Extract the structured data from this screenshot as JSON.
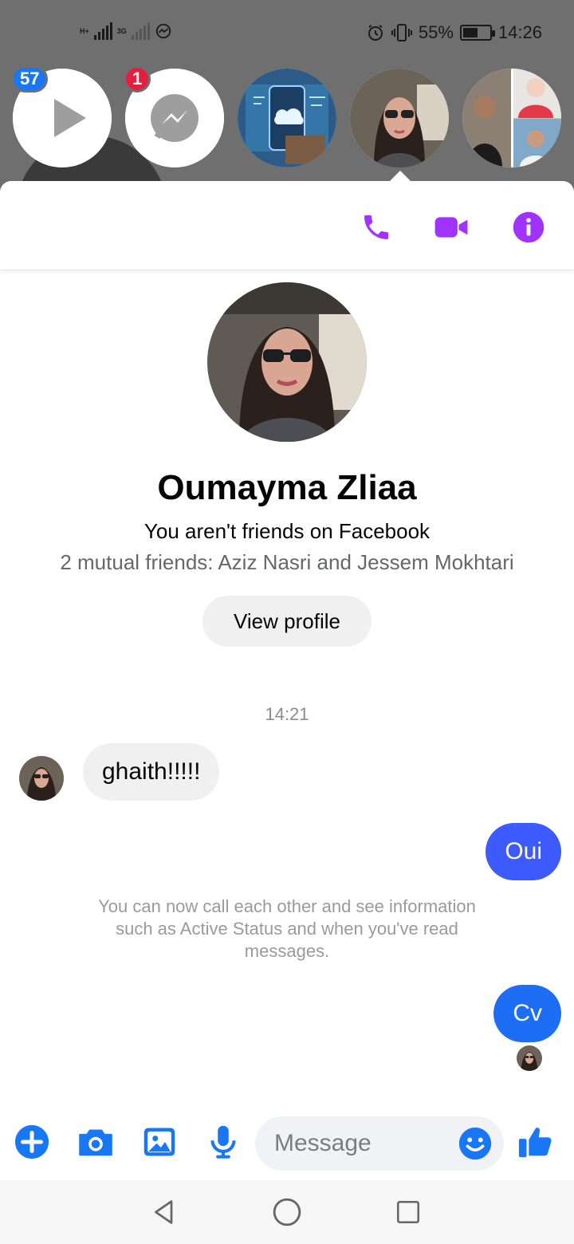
{
  "status_bar": {
    "network_left": "H+",
    "network_right": "3G",
    "battery_percent": "55%",
    "battery_level": 0.55,
    "time": "14:26",
    "icons": [
      "alarm-icon",
      "vibrate-icon",
      "battery-icon",
      "messenger-status-icon"
    ]
  },
  "chat_heads": [
    {
      "name": "video-app-head",
      "badge": "57",
      "icon": "play-icon"
    },
    {
      "name": "messenger-head",
      "badge": "1",
      "icon": "messenger-icon"
    },
    {
      "name": "tech-cloud-head",
      "icon": "cloud-photo"
    },
    {
      "name": "oumayma-head",
      "icon": "profile-photo",
      "active": true
    },
    {
      "name": "group-head",
      "icon": "group-photo"
    }
  ],
  "header": {
    "actions": [
      "phone-icon",
      "video-icon",
      "info-icon"
    ],
    "accent": "#a033ff"
  },
  "profile": {
    "name": "Oumayma Zliaa",
    "friendship_status": "You aren't friends on Facebook",
    "mutual_friends": "2 mutual friends: Aziz Nasri and Jessem Mokhtari",
    "view_profile_label": "View profile"
  },
  "conversation": {
    "time_label": "14:21",
    "incoming_message": "ghaith!!!!!",
    "outgoing_message_1": "Oui",
    "system_notice": "You can now call each other and see information such as Active Status and when you've read messages.",
    "outgoing_message_2": "Cv"
  },
  "composer": {
    "placeholder": "Message",
    "buttons": [
      "plus-icon",
      "camera-icon",
      "gallery-icon",
      "microphone-icon",
      "emoji-icon",
      "like-icon"
    ],
    "accent": "#1877f2"
  },
  "nav_bar": {
    "buttons": [
      "back-icon",
      "home-icon",
      "recents-icon"
    ]
  }
}
